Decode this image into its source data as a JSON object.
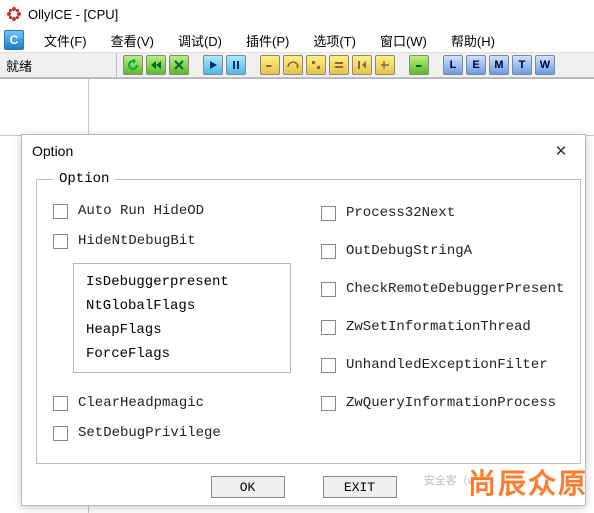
{
  "window": {
    "title": "OllyICE - [CPU]",
    "status": "就绪"
  },
  "menu": {
    "file": "文件(F)",
    "view": "查看(V)",
    "debug": "调试(D)",
    "plugin": "插件(P)",
    "option": "选项(T)",
    "window": "窗口(W)",
    "help": "帮助(H)"
  },
  "toolbar": {
    "letters": [
      "L",
      "E",
      "M",
      "T",
      "W"
    ]
  },
  "dialog": {
    "title": "Option",
    "group_legend": "Option",
    "close": "✕",
    "left": {
      "autorun": "Auto Run HideOD",
      "hidenbit": "HideNtDebugBit",
      "inner": {
        "isdbg": "IsDebuggerpresent",
        "ntglob": "NtGlobalFlags",
        "heapfl": "HeapFlags",
        "forcefl": "ForceFlags"
      },
      "clearheap": "ClearHeadpmagic",
      "setpriv": "SetDebugPrivilege"
    },
    "right": {
      "p32next": "Process32Next",
      "outdbg": "OutDebugStringA",
      "crdbg": "CheckRemoteDebuggerPresent",
      "zwsetinf": "ZwSetInformationThread",
      "unhfilter": "UnhandledExceptionFilter",
      "zwquery": "ZwQueryInformationProcess"
    },
    "buttons": {
      "ok": "OK",
      "exit": "EXIT"
    }
  },
  "watermark": {
    "big": "尚辰众原",
    "small": "安全客（www."
  }
}
